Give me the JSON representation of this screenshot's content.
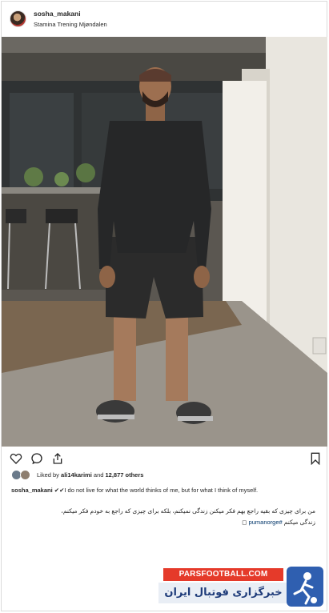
{
  "post": {
    "username": "sosha_makani",
    "location": "Stamina Trening Mjøndalen"
  },
  "actions": {
    "like_icon": "heart-icon",
    "comment_icon": "comment-icon",
    "share_icon": "share-icon",
    "save_icon": "bookmark-icon"
  },
  "likes": {
    "prefix": "Liked by ",
    "user": "ali14karimi",
    "middle": " and ",
    "count": "12,877 others"
  },
  "caption": {
    "username": "sosha_makani",
    "text": " ✔✔I do not live for what the world thinks of me, but for what I think of myself.",
    "fa_line1": "من برای چیزی که بقیه راجع بهم فکر میکنن زندگی نمیکنم، بلکه برای چیزی که راجع به خودم فکر میکنم،",
    "fa_line2_text": "زندگی میکنم ",
    "fa_line2_tag": "#pumanorge",
    "fa_line2_end": " ◻"
  },
  "watermark": {
    "top_text": "PARSFOOTBALL.COM",
    "bottom_text": "خبرگزاری فوتبال ایران"
  },
  "colors": {
    "watermark_red": "#e53a2a",
    "watermark_blue": "#2f5fb0",
    "hashtag": "#003569"
  }
}
